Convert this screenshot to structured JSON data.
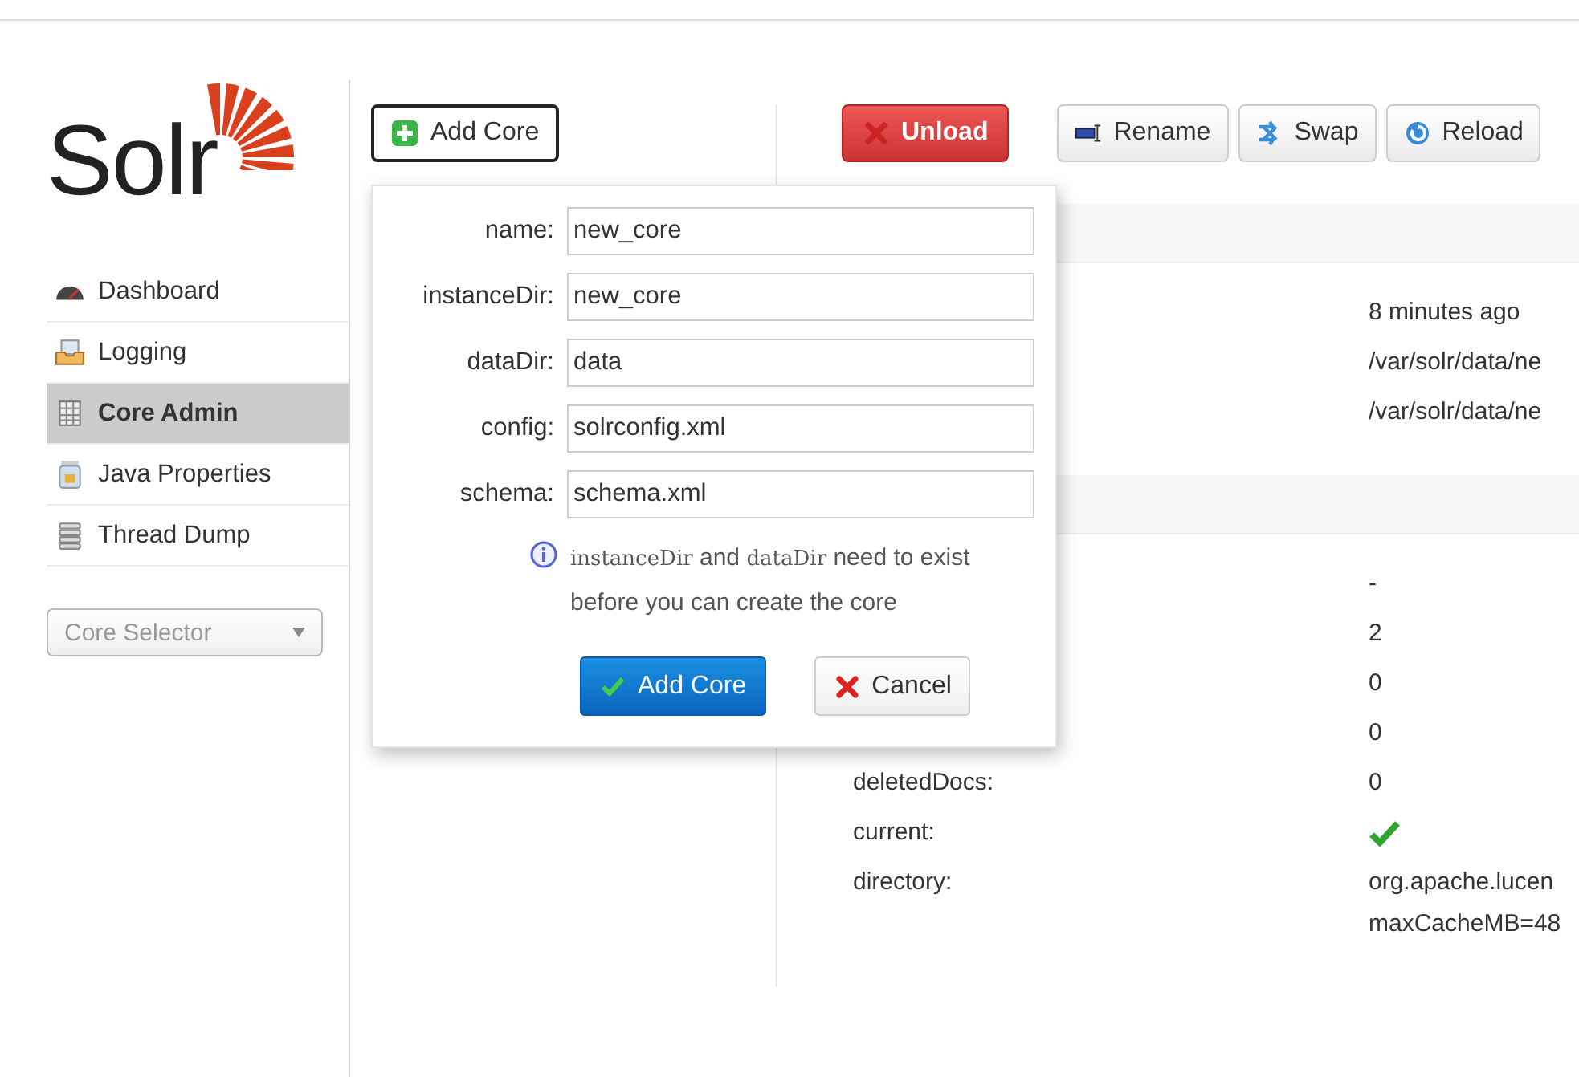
{
  "sidebar": {
    "logo": "Solr",
    "items": [
      {
        "label": "Dashboard",
        "kind": "dashboard",
        "selected": false
      },
      {
        "label": "Logging",
        "kind": "logging",
        "selected": false
      },
      {
        "label": "Core Admin",
        "kind": "cores",
        "selected": true
      },
      {
        "label": "Java Properties",
        "kind": "java",
        "selected": false
      },
      {
        "label": "Thread Dump",
        "kind": "threads",
        "selected": false
      }
    ],
    "core_selector": {
      "placeholder": "Core Selector"
    }
  },
  "add_core_button": "Add Core",
  "toolbar": [
    {
      "label": "Unload",
      "kind": "unload"
    },
    {
      "label": "Rename",
      "kind": "rename"
    },
    {
      "label": "Swap",
      "kind": "swap"
    },
    {
      "label": "Reload",
      "kind": "reload"
    }
  ],
  "sections": [
    {
      "rows": [
        {
          "value": "8 minutes ago"
        },
        {
          "value": "/var/solr/data/ne"
        },
        {
          "value": "/var/solr/data/ne"
        }
      ]
    },
    {
      "rows": [
        {
          "value": "-"
        },
        {
          "value": "2"
        },
        {
          "value": "0"
        },
        {
          "value": "0"
        },
        {
          "label": "deletedDocs:",
          "value": "0"
        },
        {
          "label": "current:",
          "kind": "check"
        },
        {
          "label": "directory:",
          "lines": [
            "org.apache.lucen",
            "maxCacheMB=48"
          ]
        }
      ]
    }
  ],
  "dialog": {
    "fields": [
      {
        "label": "name:",
        "value": "new_core"
      },
      {
        "label": "instanceDir:",
        "value": "new_core"
      },
      {
        "label": "dataDir:",
        "value": "data"
      },
      {
        "label": "config:",
        "value": "solrconfig.xml"
      },
      {
        "label": "schema:",
        "value": "schema.xml"
      }
    ],
    "note": [
      {
        "text": "instanceDir",
        "code": true
      },
      {
        "text": " and ",
        "code": false
      },
      {
        "text": "dataDir",
        "code": true
      },
      {
        "text": " need to exist before you can create the core",
        "code": false
      }
    ],
    "buttons": [
      {
        "label": "Add Core",
        "kind": "confirm"
      },
      {
        "label": "Cancel",
        "kind": "cancel"
      }
    ]
  }
}
